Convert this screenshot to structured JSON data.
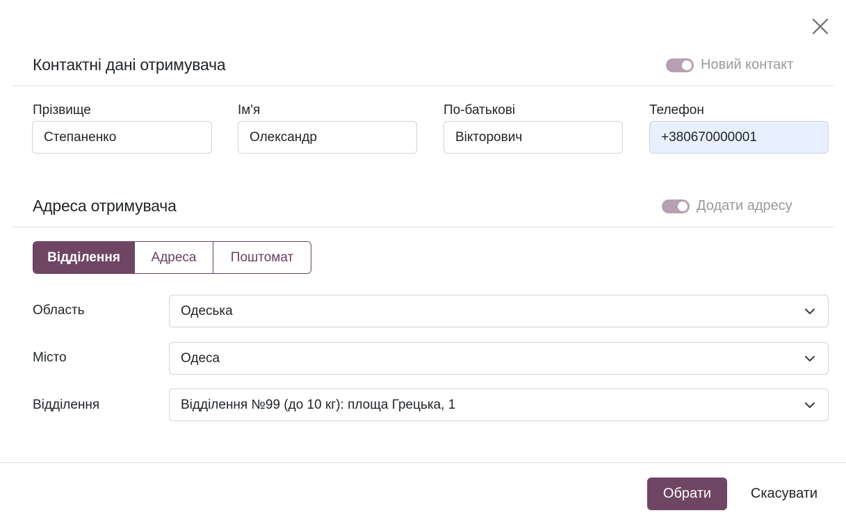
{
  "dialog": {
    "close_icon": "close-icon"
  },
  "contact": {
    "title": "Контактні дані отримувача",
    "toggle_label": "Новий контакт",
    "fields": [
      {
        "label": "Прізвище",
        "value": "Степаненко"
      },
      {
        "label": "Ім'я",
        "value": "Олександр"
      },
      {
        "label": "По-батькові",
        "value": "Вікторович"
      },
      {
        "label": "Телефон",
        "value": "+380670000001"
      }
    ]
  },
  "address": {
    "title": "Адреса отримувача",
    "toggle_label": "Додати адресу",
    "tabs": [
      {
        "label": "Відділення",
        "active": true
      },
      {
        "label": "Адреса",
        "active": false
      },
      {
        "label": "Поштомат",
        "active": false
      }
    ],
    "rows": [
      {
        "label": "Область",
        "value": "Одеська"
      },
      {
        "label": "Місто",
        "value": "Одеса"
      },
      {
        "label": "Відділення",
        "value": "Відділення №99 (до 10 кг): площа Грецька, 1"
      }
    ]
  },
  "footer": {
    "primary_label": "Обрати",
    "cancel_label": "Скасувати"
  },
  "colors": {
    "accent": "#6f4564",
    "toggle": "#b7a0b1",
    "autofill": "#e8f0fe"
  }
}
